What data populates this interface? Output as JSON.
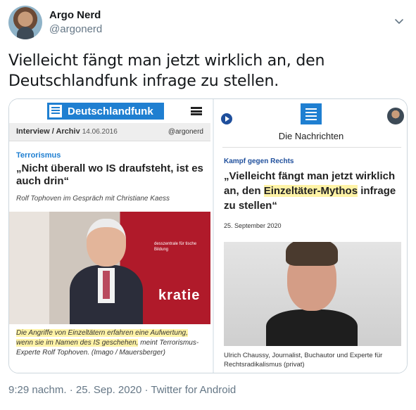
{
  "author": {
    "display_name": "Argo Nerd",
    "handle": "@argonerd"
  },
  "tweet": {
    "text_line1": "Vielleicht fängt man jetzt wirklich an, den",
    "text_line2": "Deutschlandfunk infrage zu stellen.",
    "meta": "9:29 nachm. · 25. Sep. 2020 · Twitter for Android"
  },
  "left_card": {
    "logo_text": "Deutschlandfunk",
    "section": "Interview / Archiv",
    "date": "14.06.2016",
    "handle": "@argonerd",
    "kicker": "Terrorismus",
    "headline": "„Nicht überall wo IS draufsteht, ist es auch drin“",
    "byline": "Rolf Tophoven im Gespräch mit Christiane Kaess",
    "photo_banner_text": "kratie",
    "photo_banner_small": "desszentrale für tische Bildung",
    "caption_highlight": "Die Angriffe von Einzeltätern erfahren eine Aufwertung, wenn sie im Namen des IS geschehen,",
    "caption_rest": " meint Terrorismus-Experte Rolf Tophoven. (Imago / Mauersberger)"
  },
  "right_card": {
    "title": "Die Nachrichten",
    "kicker": "Kampf gegen Rechts",
    "headline_before": "„Vielleicht fängt man jetzt wirklich an, den ",
    "headline_highlight": "Einzeltäter-Mythos",
    "headline_after": " infrage zu stellen“",
    "date": "25. September 2020",
    "caption": "Ulrich Chaussy, Journalist, Buchautor und Experte für Rechtsradikalismus (privat)"
  },
  "colors": {
    "dlf_blue": "#1f7fd1",
    "highlight": "#fff3a6",
    "text_secondary": "#657786"
  }
}
